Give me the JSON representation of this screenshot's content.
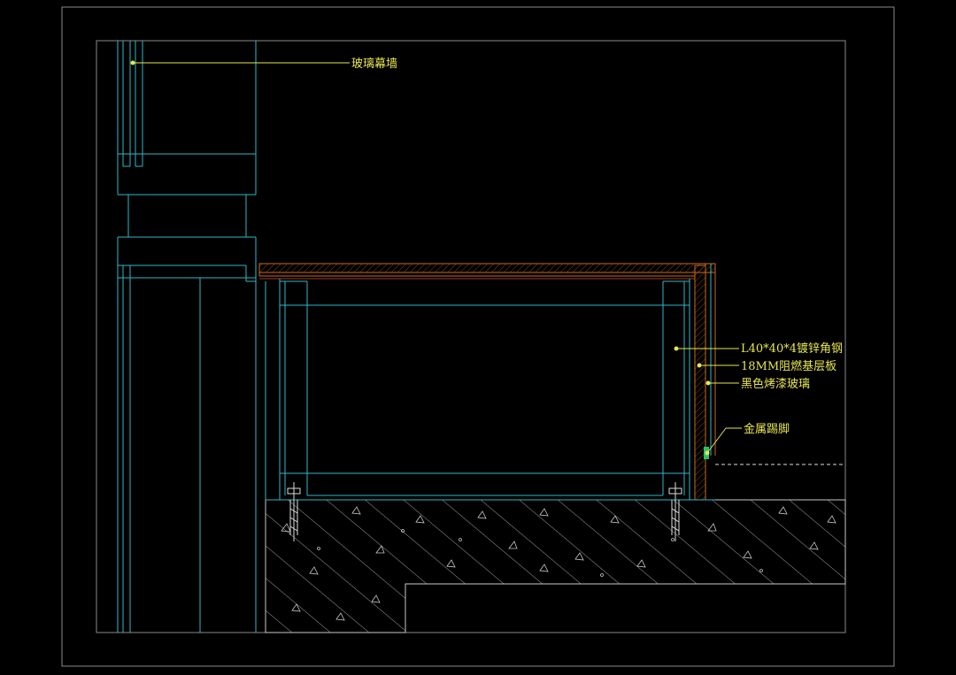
{
  "colors": {
    "background": "#000000",
    "frame": "#9a9a9a",
    "structure": "#2fb7c8",
    "cyan_dim": "#1f8f9c",
    "leader": "#e8e650",
    "label": "#e8e650",
    "wood": "#c86a1a",
    "wood_dark": "#8a4210",
    "concrete": "#c8c8c8",
    "green": "#26c26a"
  },
  "labels": {
    "curtain_wall": "玻璃幕墙",
    "angle_steel": "L40*40*4镀锌角钢",
    "fire_board": "18MM阻燃基层板",
    "black_glass": "黑色烤漆玻璃",
    "metal_skirting": "金属踢脚"
  }
}
